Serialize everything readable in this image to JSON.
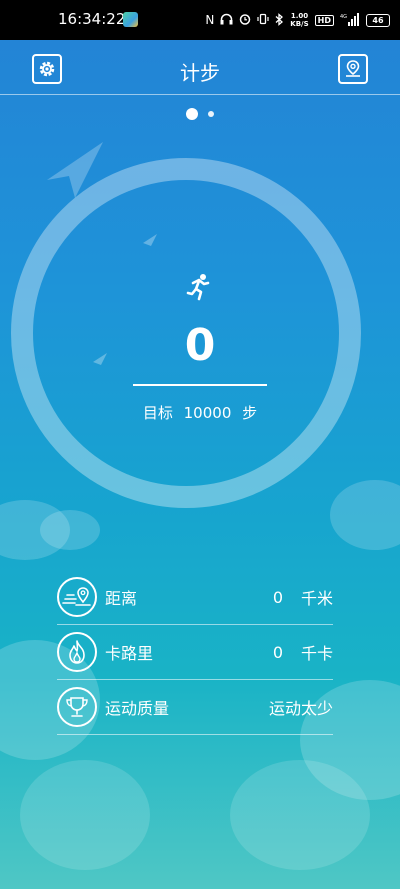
{
  "status_bar": {
    "time": "16:34:22",
    "net_speed_value": "1.00",
    "net_speed_unit": "KB/S",
    "hd_label": "HD",
    "signal_label": "4G",
    "battery": "46"
  },
  "header": {
    "title": "计步"
  },
  "pager": {
    "pages": 2,
    "active": 0
  },
  "pedometer": {
    "steps": "0",
    "goal_label": "目标",
    "goal_value": "10000",
    "goal_unit": "步"
  },
  "stats": [
    {
      "label": "距离",
      "value": "0",
      "unit": "千米",
      "icon": "distance-pin-icon"
    },
    {
      "label": "卡路里",
      "value": "0",
      "unit": "千卡",
      "icon": "flame-icon"
    },
    {
      "label": "运动质量",
      "value": "运动太少",
      "unit": "",
      "icon": "trophy-icon"
    }
  ],
  "colors": {
    "status_bar_bg": "#000000",
    "bg_top": "#2384d6",
    "bg_bottom": "#4fc7c5",
    "foreground": "#ffffff"
  }
}
